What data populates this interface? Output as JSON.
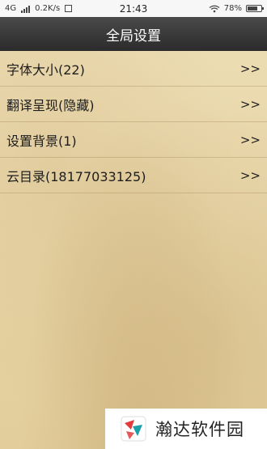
{
  "status_bar": {
    "network": "4G",
    "speed": "0.2K/s",
    "time": "21:43",
    "battery_percent": "78%",
    "battery_level": 0.78
  },
  "title_bar": {
    "title": "全局设置"
  },
  "settings": {
    "items": [
      {
        "label": "字体大小(22)",
        "chevron": ">>"
      },
      {
        "label": "翻译呈现(隐藏)",
        "chevron": ">>"
      },
      {
        "label": "设置背景(1)",
        "chevron": ">>"
      },
      {
        "label": "云目录(18177033125)",
        "chevron": ">>"
      }
    ]
  },
  "watermark": {
    "text": "瀚达软件园"
  },
  "colors": {
    "title_bar": "#2f2f2f",
    "paper": "#e9d7ab",
    "text": "#1d1d1d"
  }
}
